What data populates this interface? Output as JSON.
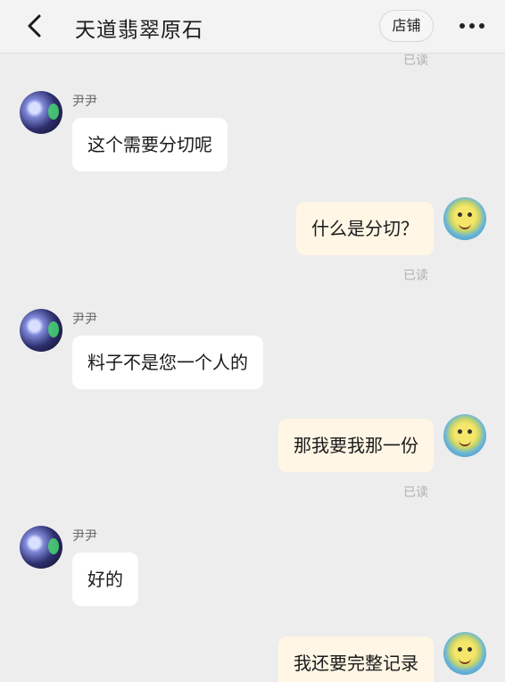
{
  "header": {
    "title": "天道翡翠原石",
    "shop_label": "店铺"
  },
  "read_label": "已读",
  "messages": [
    {
      "from": "other",
      "nickname": "尹尹",
      "text": "这个需要分切呢"
    },
    {
      "from": "me",
      "text": "什么是分切？",
      "status": "已读"
    },
    {
      "from": "other",
      "nickname": "尹尹",
      "text": "料子不是您一个人的"
    },
    {
      "from": "me",
      "text": "那我要我那一份",
      "status": "已读"
    },
    {
      "from": "other",
      "nickname": "尹尹",
      "text": "好的"
    },
    {
      "from": "me",
      "text": "我还要完整记录"
    }
  ]
}
